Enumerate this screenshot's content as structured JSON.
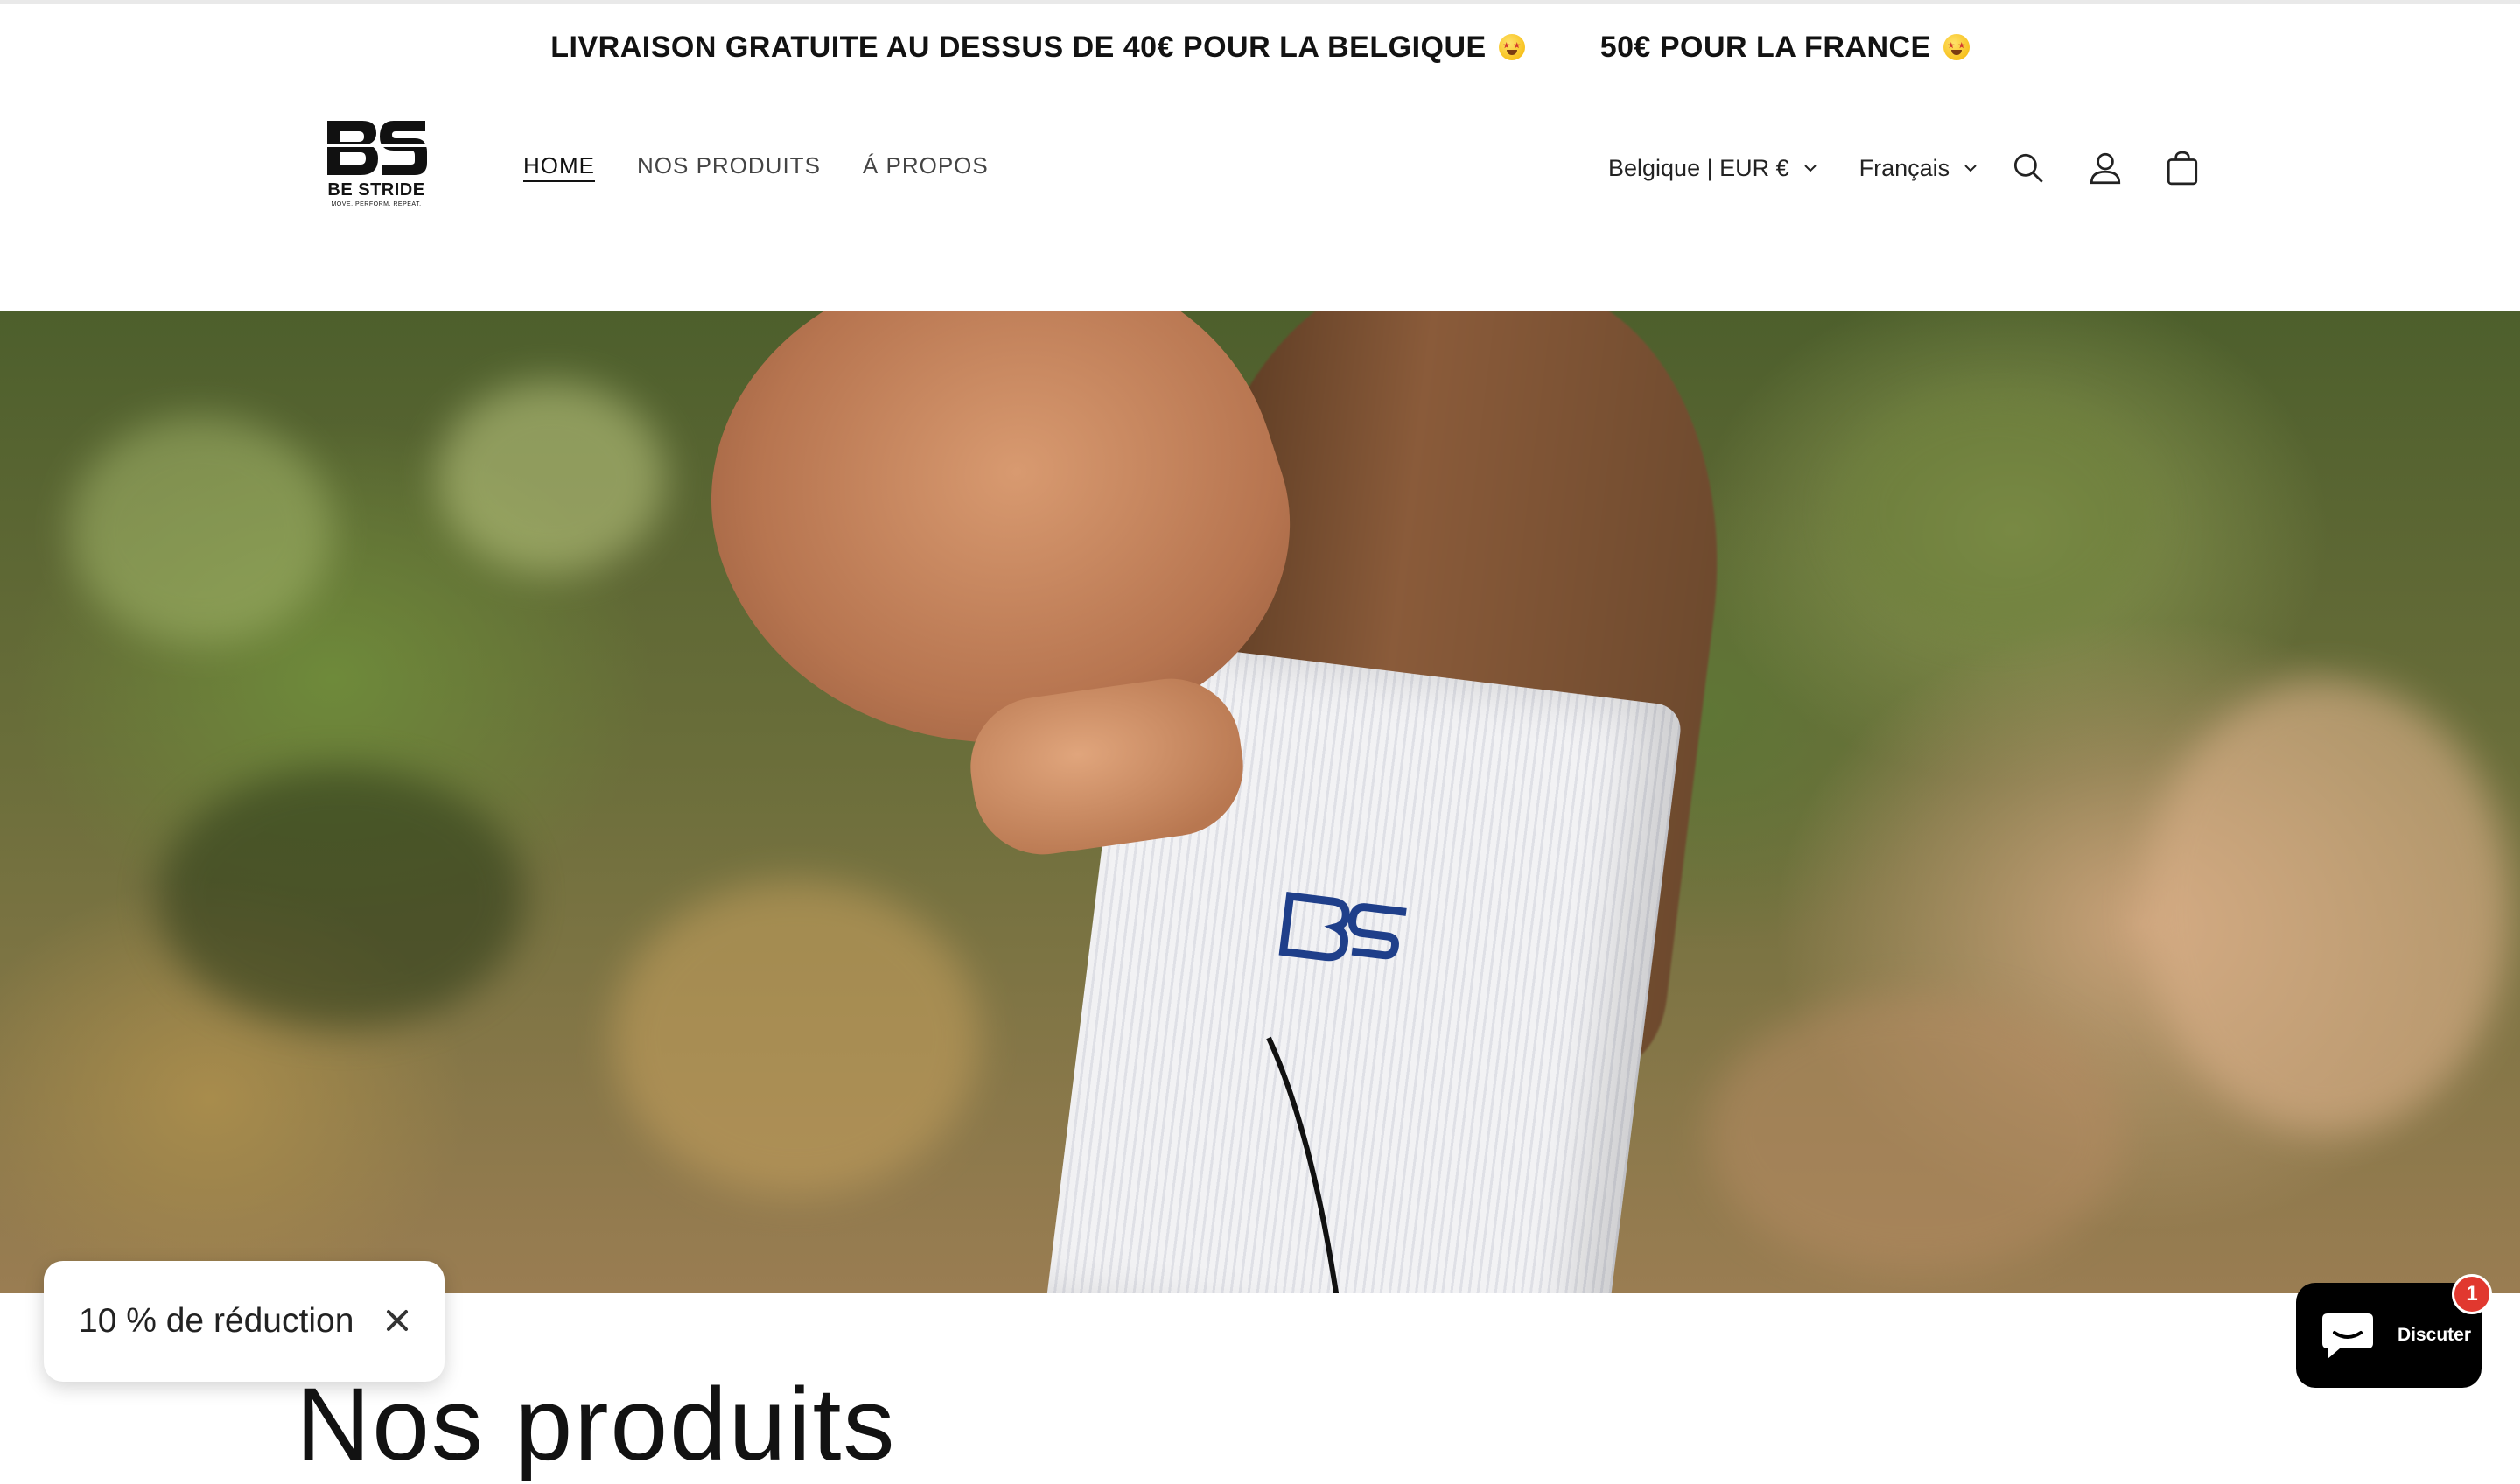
{
  "announcement": {
    "message_1": "LIVRAISON GRATUITE AU DESSUS DE 40€ POUR LA BELGIQUE",
    "message_2": "50€ POUR LA FRANCE"
  },
  "header": {
    "logo_name": "BE STRIDE",
    "logo_tagline": "MOVE. PERFORM. REPEAT.",
    "nav": [
      {
        "label": "HOME",
        "active": true
      },
      {
        "label": "NOS PRODUITS",
        "active": false
      },
      {
        "label": "Á PROPOS",
        "active": false
      }
    ],
    "country_selector": "Belgique | EUR €",
    "language_selector": "Français",
    "icons": [
      "search-icon",
      "account-icon",
      "cart-icon"
    ]
  },
  "hero": {
    "image_subject": "white Be Stride sport sock with blue BS logo"
  },
  "discount_popup": {
    "label": "10 % de réduction"
  },
  "section": {
    "title": "Nos produits"
  },
  "chat_widget": {
    "label": "Discuter",
    "badge_count": "1"
  },
  "colors": {
    "text": "#121212",
    "brand_blue": "#1f3f8a",
    "chat_bg": "#000000",
    "badge_red": "#e1382f"
  }
}
